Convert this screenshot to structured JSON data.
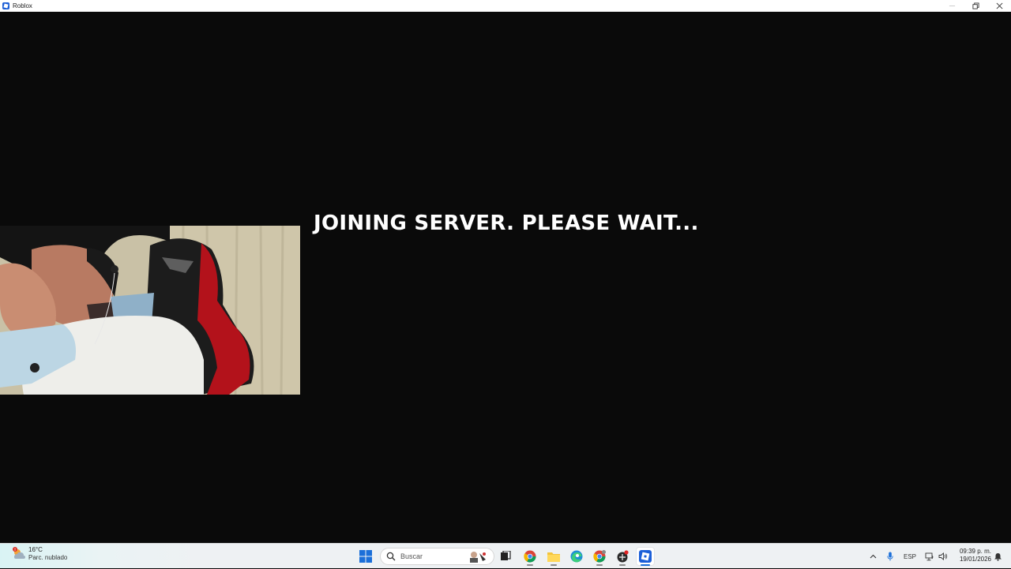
{
  "window": {
    "title": "Roblox",
    "controls": {
      "minimize": "—",
      "maximize": "❐",
      "close": "✕"
    }
  },
  "game": {
    "status_text": "JOINING SERVER. PLEASE WAIT..."
  },
  "taskbar": {
    "weather": {
      "temp": "16°C",
      "desc": "Parc. nublado",
      "alert_badge": "!"
    },
    "search": {
      "placeholder": "Buscar"
    },
    "apps": [
      {
        "name": "task-view",
        "icon": "task-view-icon"
      },
      {
        "name": "chrome",
        "icon": "chrome-icon"
      },
      {
        "name": "file-explorer",
        "icon": "folder-icon"
      },
      {
        "name": "edge",
        "icon": "edge-icon"
      },
      {
        "name": "chrome-profile",
        "icon": "chrome-icon"
      },
      {
        "name": "game-app",
        "icon": "game-icon"
      },
      {
        "name": "roblox",
        "icon": "roblox-icon"
      }
    ],
    "tray": {
      "chevron": "^",
      "language": "ESP",
      "clock_time": "09:39 p. m.",
      "clock_date": "19/01/2026"
    }
  },
  "colors": {
    "background": "#0a0a0a",
    "text": "#ffffff",
    "taskbar": "#eef1f3",
    "windows_blue": "#1b6fd9"
  }
}
